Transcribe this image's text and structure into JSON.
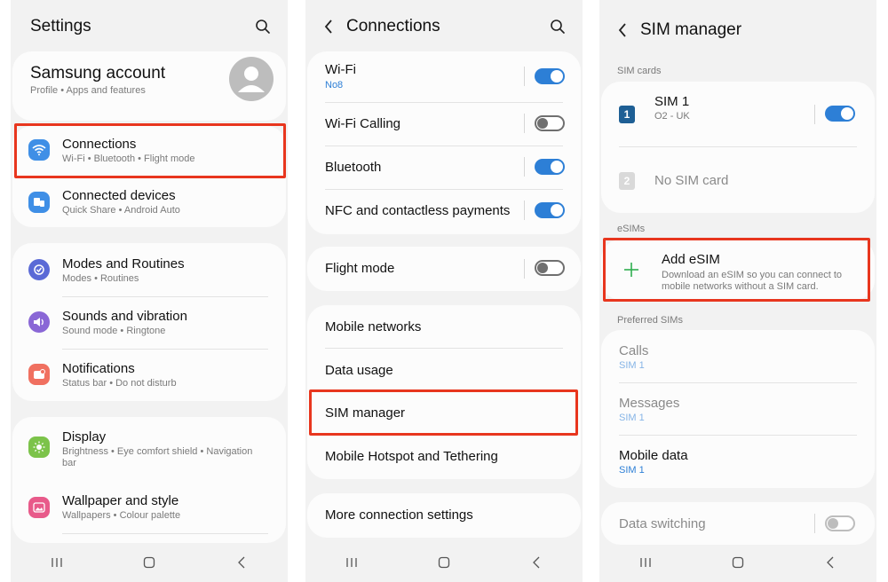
{
  "settings": {
    "title": "Settings",
    "account": {
      "name": "Samsung account",
      "subtitle": "Profile  •  Apps and features"
    },
    "items": [
      {
        "title": "Connections",
        "subtitle": "Wi-Fi  •  Bluetooth  •  Flight mode",
        "icon": "wifi-icon",
        "color": "#3f8fe6"
      },
      {
        "title": "Connected devices",
        "subtitle": "Quick Share  •  Android Auto",
        "icon": "connected-devices-icon",
        "color": "#3f8fe6"
      },
      {
        "title": "Modes and Routines",
        "subtitle": "Modes  •  Routines",
        "icon": "modes-icon",
        "color": "#5b6ad6"
      },
      {
        "title": "Sounds and vibration",
        "subtitle": "Sound mode  •  Ringtone",
        "icon": "sound-icon",
        "color": "#8a67d6"
      },
      {
        "title": "Notifications",
        "subtitle": "Status bar  •  Do not disturb",
        "icon": "notifications-icon",
        "color": "#f07060"
      },
      {
        "title": "Display",
        "subtitle_line1": "Brightness  •  Eye comfort shield  •  Navigation",
        "subtitle_line2": "bar",
        "icon": "display-icon",
        "color": "#7cc34a"
      },
      {
        "title": "Wallpaper and style",
        "subtitle": "Wallpapers  •  Colour palette",
        "icon": "wallpaper-icon",
        "color": "#e85a8a"
      }
    ]
  },
  "connections": {
    "title": "Connections",
    "wifi": {
      "label": "Wi-Fi",
      "network": "No8",
      "on": true
    },
    "wifi_calling": {
      "label": "Wi-Fi Calling",
      "on": false
    },
    "bluetooth": {
      "label": "Bluetooth",
      "on": true
    },
    "nfc": {
      "label": "NFC and contactless payments",
      "on": true
    },
    "flight_mode": {
      "label": "Flight mode",
      "on": false
    },
    "mobile_networks": "Mobile networks",
    "data_usage": "Data usage",
    "sim_manager": "SIM manager",
    "hotspot": "Mobile Hotspot and Tethering",
    "more": "More connection settings"
  },
  "sim_manager": {
    "title": "SIM manager",
    "sim_cards_label": "SIM cards",
    "sim1": {
      "badge": "1",
      "name": "SIM 1",
      "carrier": "O2 - UK",
      "on": true
    },
    "sim2": {
      "badge": "2",
      "name": "No SIM card"
    },
    "esims_label": "eSIMs",
    "add_esim": {
      "title": "Add eSIM",
      "desc_line1": "Download an eSIM so you can connect to",
      "desc_line2": "mobile networks without a SIM card."
    },
    "preferred_label": "Preferred SIMs",
    "calls": {
      "label": "Calls",
      "value": "SIM 1"
    },
    "messages": {
      "label": "Messages",
      "value": "SIM 1"
    },
    "mobile_data": {
      "label": "Mobile data",
      "value": "SIM 1"
    },
    "data_switching": {
      "label": "Data switching",
      "on": false
    }
  },
  "colors": {
    "accent": "#2d7fd6",
    "highlight": "#e8361e",
    "add_green": "#2fae4f"
  }
}
